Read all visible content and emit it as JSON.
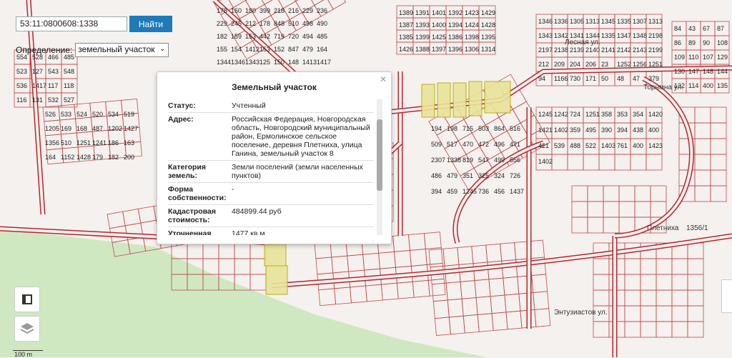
{
  "search": {
    "value": "53:11:0800608:1338",
    "button_label": "Найти"
  },
  "definition": {
    "label": "Определение:",
    "selected": "земельный участок"
  },
  "popup": {
    "title": "Земельный участок",
    "rows": [
      {
        "label": "Статус:",
        "value": "Учтенный"
      },
      {
        "label": "Адрес:",
        "value": "Российская Федерация, Новгородская область, Новгородский муниципальный район, Ермолинское сельское поселение, деревня Плетниха, улица Ганина, земельный участок 8"
      },
      {
        "label": "Категория земель:",
        "value": "Земли поселений (земли населенных пунктов)"
      },
      {
        "label": "Форма собственности:",
        "value": "-"
      },
      {
        "label": "Кадастровая стоимость:",
        "value": "484899.44 руб"
      },
      {
        "label": "Уточненная площадь:",
        "value": "1477 кв.м"
      }
    ]
  },
  "scale_label": "100 m",
  "street_labels": [
    "Плетниха",
    "1356/1",
    "Лесная ул.",
    "Торнмна ул.",
    "Энтузиастов ул."
  ],
  "parcels": [
    "1389",
    "1391",
    "1401",
    "1392",
    "1423",
    "1429",
    "1387",
    "1393",
    "1400",
    "1394",
    "1424",
    "1428",
    "1385",
    "1399",
    "1425",
    "1386",
    "1398",
    "1395",
    "1426",
    "1388",
    "1397",
    "1396",
    "1306",
    "1314",
    "1346",
    "1336",
    "1305",
    "1313",
    "1345",
    "1335",
    "1307",
    "1313",
    "1343",
    "1342",
    "1341",
    "1344",
    "1335",
    "1347",
    "1348",
    "2198",
    "2197",
    "2138",
    "2139",
    "2140",
    "2141",
    "2142",
    "2143",
    "2199",
    "212",
    "209",
    "204",
    "206",
    "23",
    "1252",
    "1256",
    "1251",
    "94",
    "1166",
    "730",
    "171",
    "50",
    "48",
    "47",
    "379",
    "84",
    "43",
    "67",
    "87",
    "86",
    "89",
    "90",
    "108",
    "109",
    "110",
    "107",
    "129",
    "130",
    "147",
    "148",
    "144",
    "132",
    "114",
    "400",
    "135",
    "178",
    "160",
    "180",
    "399",
    "218",
    "216",
    "229",
    "236",
    "229",
    "245",
    "212",
    "178",
    "848",
    "510",
    "498",
    "490",
    "182",
    "159",
    "153",
    "442",
    "719",
    "720",
    "494",
    "485",
    "155",
    "154",
    "1412",
    "153",
    "152",
    "847",
    "479",
    "164",
    "1344",
    "1346",
    "1343",
    "125",
    "150",
    "148",
    "1413",
    "1417",
    "554",
    "528",
    "466",
    "485",
    "523",
    "127",
    "543",
    "548",
    "536",
    "1417",
    "117",
    "118",
    "116",
    "131",
    "532",
    "527",
    "526",
    "533",
    "524",
    "520",
    "534",
    "519",
    "1205",
    "169",
    "168",
    "487",
    "1202",
    "1427",
    "1356",
    "510",
    "1251",
    "1241",
    "186",
    "163",
    "164",
    "1152",
    "1428",
    "179",
    "182",
    "200",
    "194",
    "198",
    "715",
    "503",
    "864",
    "516",
    "509",
    "517",
    "470",
    "472",
    "496",
    "471",
    "2307",
    "1338",
    "819",
    "547",
    "499",
    "556",
    "486",
    "479",
    "351",
    "325",
    "324",
    "726",
    "394",
    "459",
    "1245",
    "736",
    "456",
    "1437",
    "1245",
    "1242",
    "724",
    "1251",
    "358",
    "353",
    "354",
    "1420",
    "1421",
    "1402",
    "359",
    "495",
    "390",
    "394",
    "438",
    "400",
    "421",
    "539",
    "488",
    "522",
    "1403",
    "761",
    "400",
    "1423",
    "1402"
  ]
}
